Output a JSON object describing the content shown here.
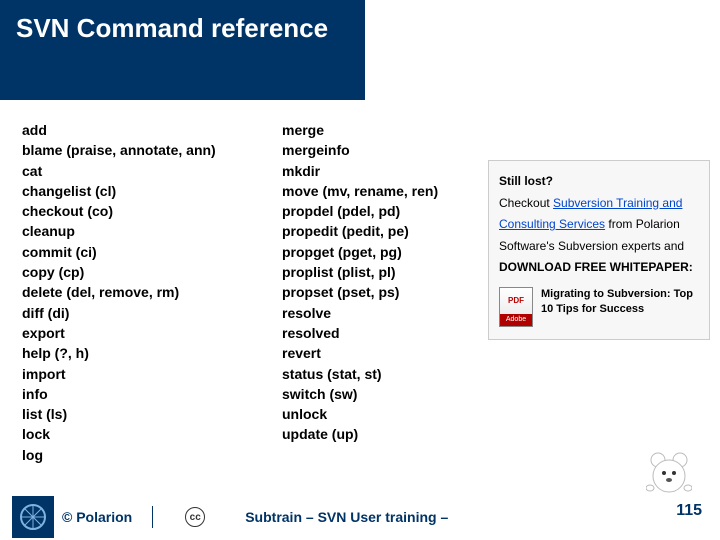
{
  "title": "SVN Command reference",
  "commands_col1": [
    "add",
    "blame (praise, annotate, ann)",
    "cat",
    "changelist (cl)",
    "checkout (co)",
    "cleanup",
    "commit (ci)",
    "copy (cp)",
    "delete (del, remove, rm)",
    "diff (di)",
    "export",
    "help (?, h)",
    "import",
    "info",
    "list (ls)",
    "lock",
    "log"
  ],
  "commands_col2": [
    "merge",
    "mergeinfo",
    "mkdir",
    "move (mv, rename, ren)",
    "propdel (pdel, pd)",
    "propedit (pedit, pe)",
    "propget (pget, pg)",
    "proplist (plist, pl)",
    "propset (pset, ps)",
    "resolve",
    "resolved",
    "revert",
    "status (stat, st)",
    "switch (sw)",
    "unlock",
    "update (up)"
  ],
  "promo": {
    "lead": "Still lost?",
    "text1a": "Checkout ",
    "link1": "Subversion Training and Consulting Services",
    "text1b": " from Polarion Software's Subversion experts and ",
    "bold1": "DOWNLOAD FREE WHITEPAPER:",
    "wp_title": "Migrating to Subversion: Top 10 Tips for Success",
    "pdf_label": "PDF",
    "adobe_label": "Adobe"
  },
  "footer": {
    "copyright": "© Polarion",
    "cc": "cc",
    "subtitle": "Subtrain – SVN User training –",
    "page": "115"
  }
}
